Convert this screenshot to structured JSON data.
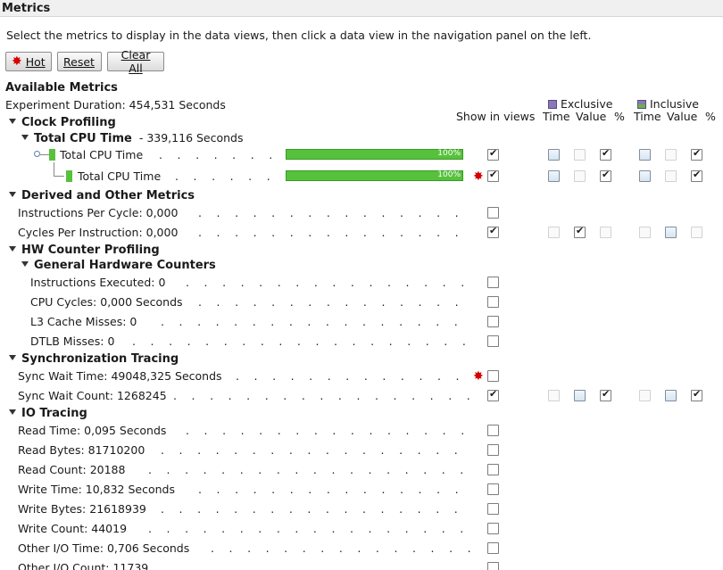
{
  "window": {
    "title": "Metrics"
  },
  "instructions": "Select the metrics to display in the data views, then click a data view in the navigation panel on the left.",
  "buttons": {
    "hot": "Hot",
    "reset": "Reset",
    "clear_all": "Clear All"
  },
  "available_heading": "Available Metrics",
  "experiment_duration": "Experiment Duration: 454,531 Seconds",
  "column_headers": {
    "show_in_views": "Show in views",
    "exclusive": "Exclusive",
    "inclusive": "Inclusive",
    "time": "Time",
    "value": "Value",
    "percent": "%"
  },
  "sections": {
    "clock": "Clock Profiling",
    "total_cpu_group": "Total CPU Time",
    "total_cpu_group_suffix": "- 339,116 Seconds",
    "derived": "Derived and Other Metrics",
    "hw": "HW Counter Profiling",
    "general_hw": "General Hardware Counters",
    "sync": "Synchronization Tracing",
    "io": "IO Tracing"
  },
  "cpu_rows": [
    {
      "label": "Total CPU Time",
      "percent_label": "100%",
      "percent": 100
    },
    {
      "label": "Total CPU Time",
      "percent_label": "100%",
      "percent": 100
    }
  ],
  "derived_rows": [
    {
      "label": "Instructions Per Cycle: 0,000"
    },
    {
      "label": "Cycles Per Instruction: 0,000"
    }
  ],
  "hw_rows": [
    {
      "label": "Instructions Executed: 0"
    },
    {
      "label": "CPU Cycles: 0,000 Seconds"
    },
    {
      "label": "L3 Cache Misses: 0"
    },
    {
      "label": "DTLB Misses: 0"
    }
  ],
  "sync_rows": [
    {
      "label": "Sync Wait Time: 49048,325 Seconds"
    },
    {
      "label": "Sync Wait Count: 1268245"
    }
  ],
  "io_rows": [
    {
      "label": "Read Time: 0,095 Seconds"
    },
    {
      "label": "Read Bytes: 81710200"
    },
    {
      "label": "Read Count: 20188"
    },
    {
      "label": "Write Time: 10,832 Seconds"
    },
    {
      "label": "Write Bytes: 21618939"
    },
    {
      "label": "Write Count: 44019"
    },
    {
      "label": "Other I/O Time: 0,706 Seconds"
    },
    {
      "label": "Other I/O Count: 11739"
    }
  ],
  "icons": {
    "hot": "red-star-icon",
    "exclusive": "exclusive-metric-icon",
    "inclusive": "inclusive-metric-icon"
  },
  "colors": {
    "bar": "#56c23c",
    "star": "#d40000",
    "exclusive_icon": "#8a78b8",
    "inclusive_icon": "#6fb04a"
  }
}
